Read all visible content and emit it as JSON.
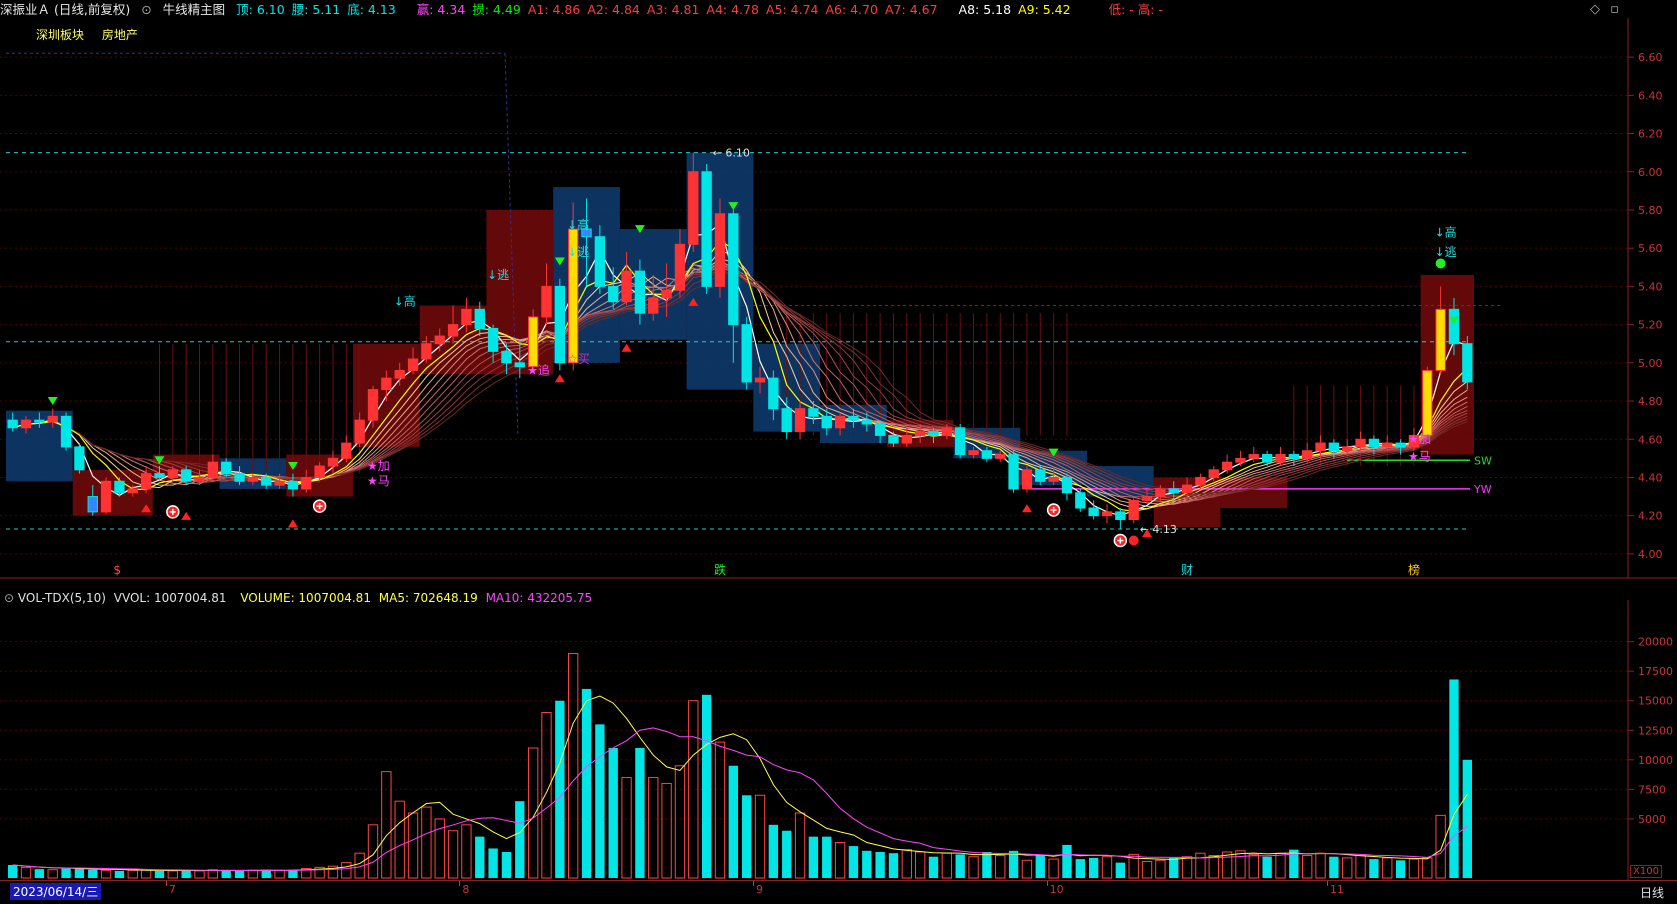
{
  "header": {
    "title": "深振业Ａ (日线,前复权)",
    "indicator": "牛线精主图",
    "fields": [
      {
        "label": "顶: 6.10",
        "color": "#00e5e5"
      },
      {
        "label": "腰: 5.11",
        "color": "#00e5e5"
      },
      {
        "label": "底: 4.13",
        "color": "#00e5e5"
      },
      {
        "label": "赢: 4.34",
        "color": "#ff44ff"
      },
      {
        "label": "损: 4.49",
        "color": "#00ee00"
      },
      {
        "label": "A1: 4.86",
        "color": "#ff3b3b"
      },
      {
        "label": "A2: 4.84",
        "color": "#ff3b3b"
      },
      {
        "label": "A3: 4.81",
        "color": "#ff3b3b"
      },
      {
        "label": "A4: 4.78",
        "color": "#ff3b3b"
      },
      {
        "label": "A5: 4.74",
        "color": "#ff3b3b"
      },
      {
        "label": "A6: 4.70",
        "color": "#ff3b3b"
      },
      {
        "label": "A7: 4.67",
        "color": "#ff3b3b"
      },
      {
        "label": "A8: 5.18",
        "color": "#ffffff"
      },
      {
        "label": "A9: 5.42",
        "color": "#ffff00"
      }
    ],
    "low_high": "低: - 高: -"
  },
  "sector": {
    "board": "深圳板块",
    "industry": "房地产"
  },
  "price_axis": [
    "6.60",
    "6.40",
    "6.20",
    "6.00",
    "5.80",
    "5.60",
    "5.40",
    "5.20",
    "5.00",
    "4.80",
    "4.60",
    "4.40",
    "4.20",
    "4.00"
  ],
  "volume_axis": [
    "20000",
    "17500",
    "15000",
    "12500",
    "10000",
    "7500",
    "5000"
  ],
  "volume_header": {
    "name": "VOL-TDX(5,10)",
    "vvol": "VVOL: 1007004.81",
    "volume": "VOLUME: 1007004.81",
    "ma5": "MA5: 702648.19",
    "ma10": "MA10: 432205.75"
  },
  "volume_unit": "X100",
  "annotations": {
    "top_price": "6.10",
    "bottom_price": "4.13",
    "sw": "SW",
    "yw": "YW",
    "event_markers": [
      "$",
      "跌",
      "财",
      "榜"
    ],
    "signals": [
      "↓高",
      "↓逃",
      "↓逃",
      "↓高",
      "★追",
      "☆买",
      "★加",
      "★马",
      "★加",
      "★马",
      "↓高",
      "↓逃"
    ]
  },
  "date_axis": {
    "start": "2023/06/14/三",
    "months": [
      "7",
      "8",
      "9",
      "10",
      "11"
    ],
    "period": "日线"
  },
  "colors": {
    "up": "#ff3333",
    "down": "#00e5e5",
    "bg": "#000000",
    "grid": "#5a0000"
  },
  "chart_data": {
    "type": "candlestick",
    "title": "深振业Ａ (日线,前复权)",
    "ylim": [
      3.9,
      6.7
    ],
    "volume_ylim": [
      0,
      22000
    ],
    "candles": [
      [
        4.7,
        4.66,
        4.74,
        4.64
      ],
      [
        4.66,
        4.7,
        4.72,
        4.63
      ],
      [
        4.7,
        4.69,
        4.74,
        4.66
      ],
      [
        4.69,
        4.72,
        4.76,
        4.66
      ],
      [
        4.72,
        4.56,
        4.74,
        4.54
      ],
      [
        4.56,
        4.44,
        4.58,
        4.42
      ],
      [
        4.3,
        4.22,
        4.36,
        4.2
      ],
      [
        4.22,
        4.38,
        4.4,
        4.21
      ],
      [
        4.38,
        4.32,
        4.4,
        4.3
      ],
      [
        4.32,
        4.34,
        4.36,
        4.3
      ],
      [
        4.34,
        4.42,
        4.46,
        4.32
      ],
      [
        4.42,
        4.4,
        4.46,
        4.38
      ],
      [
        4.4,
        4.44,
        4.46,
        4.38
      ],
      [
        4.44,
        4.38,
        4.46,
        4.36
      ],
      [
        4.38,
        4.4,
        4.44,
        4.36
      ],
      [
        4.4,
        4.48,
        4.52,
        4.38
      ],
      [
        4.48,
        4.42,
        4.5,
        4.4
      ],
      [
        4.42,
        4.38,
        4.46,
        4.36
      ],
      [
        4.38,
        4.4,
        4.42,
        4.36
      ],
      [
        4.4,
        4.36,
        4.42,
        4.34
      ],
      [
        4.36,
        4.38,
        4.42,
        4.34
      ],
      [
        4.38,
        4.34,
        4.42,
        4.3
      ],
      [
        4.34,
        4.4,
        4.44,
        4.32
      ],
      [
        4.4,
        4.46,
        4.48,
        4.38
      ],
      [
        4.46,
        4.5,
        4.54,
        4.42
      ],
      [
        4.5,
        4.58,
        4.62,
        4.48
      ],
      [
        4.58,
        4.7,
        4.74,
        4.56
      ],
      [
        4.7,
        4.86,
        4.88,
        4.66
      ],
      [
        4.86,
        4.92,
        4.96,
        4.8
      ],
      [
        4.92,
        4.96,
        5.0,
        4.88
      ],
      [
        4.96,
        5.02,
        5.08,
        4.94
      ],
      [
        5.02,
        5.1,
        5.14,
        5.0
      ],
      [
        5.1,
        5.14,
        5.18,
        5.06
      ],
      [
        5.14,
        5.2,
        5.3,
        5.1
      ],
      [
        5.2,
        5.28,
        5.34,
        5.16
      ],
      [
        5.28,
        5.18,
        5.32,
        5.14
      ],
      [
        5.18,
        5.06,
        5.2,
        5.0
      ],
      [
        5.06,
        5.0,
        5.1,
        4.94
      ],
      [
        5.0,
        4.98,
        5.12,
        4.92
      ],
      [
        4.98,
        5.24,
        5.28,
        4.96
      ],
      [
        5.24,
        5.4,
        5.52,
        5.2
      ],
      [
        5.4,
        5.0,
        5.44,
        4.96
      ],
      [
        5.0,
        5.7,
        5.84,
        4.96
      ],
      [
        5.7,
        5.66,
        5.86,
        5.4
      ],
      [
        5.66,
        5.4,
        5.72,
        5.36
      ],
      [
        5.4,
        5.32,
        5.5,
        5.28
      ],
      [
        5.32,
        5.48,
        5.58,
        5.3
      ],
      [
        5.48,
        5.26,
        5.54,
        5.2
      ],
      [
        5.26,
        5.34,
        5.46,
        5.22
      ],
      [
        5.34,
        5.38,
        5.52,
        5.24
      ],
      [
        5.38,
        5.62,
        5.7,
        5.34
      ],
      [
        5.62,
        6.0,
        6.1,
        5.58
      ],
      [
        6.0,
        5.4,
        6.04,
        5.36
      ],
      [
        5.4,
        5.78,
        5.86,
        5.34
      ],
      [
        5.78,
        5.2,
        5.8,
        5.0
      ],
      [
        5.2,
        4.9,
        5.24,
        4.86
      ],
      [
        4.9,
        4.92,
        4.98,
        4.84
      ],
      [
        4.92,
        4.76,
        4.96,
        4.7
      ],
      [
        4.76,
        4.64,
        4.82,
        4.6
      ],
      [
        4.64,
        4.76,
        4.8,
        4.6
      ],
      [
        4.76,
        4.72,
        4.8,
        4.68
      ],
      [
        4.72,
        4.66,
        4.76,
        4.62
      ],
      [
        4.66,
        4.72,
        4.74,
        4.62
      ],
      [
        4.72,
        4.7,
        4.76,
        4.66
      ],
      [
        4.7,
        4.68,
        4.74,
        4.64
      ],
      [
        4.68,
        4.62,
        4.7,
        4.58
      ],
      [
        4.62,
        4.58,
        4.64,
        4.56
      ],
      [
        4.58,
        4.62,
        4.66,
        4.56
      ],
      [
        4.62,
        4.64,
        4.68,
        4.58
      ],
      [
        4.64,
        4.62,
        4.66,
        4.58
      ],
      [
        4.62,
        4.66,
        4.68,
        4.6
      ],
      [
        4.66,
        4.52,
        4.68,
        4.5
      ],
      [
        4.52,
        4.54,
        4.56,
        4.5
      ],
      [
        4.54,
        4.5,
        4.56,
        4.48
      ],
      [
        4.5,
        4.52,
        4.54,
        4.48
      ],
      [
        4.52,
        4.34,
        4.54,
        4.32
      ],
      [
        4.34,
        4.44,
        4.46,
        4.32
      ],
      [
        4.44,
        4.38,
        4.46,
        4.36
      ],
      [
        4.38,
        4.4,
        4.46,
        4.36
      ],
      [
        4.4,
        4.32,
        4.42,
        4.28
      ],
      [
        4.32,
        4.24,
        4.34,
        4.22
      ],
      [
        4.24,
        4.2,
        4.28,
        4.18
      ],
      [
        4.2,
        4.22,
        4.26,
        4.16
      ],
      [
        4.22,
        4.18,
        4.24,
        4.13
      ],
      [
        4.18,
        4.28,
        4.3,
        4.16
      ],
      [
        4.28,
        4.3,
        4.34,
        4.26
      ],
      [
        4.3,
        4.34,
        4.36,
        4.28
      ],
      [
        4.34,
        4.32,
        4.38,
        4.26
      ],
      [
        4.32,
        4.36,
        4.4,
        4.28
      ],
      [
        4.36,
        4.4,
        4.42,
        4.34
      ],
      [
        4.4,
        4.44,
        4.46,
        4.38
      ],
      [
        4.44,
        4.48,
        4.52,
        4.42
      ],
      [
        4.48,
        4.5,
        4.54,
        4.46
      ],
      [
        4.5,
        4.52,
        4.56,
        4.48
      ],
      [
        4.52,
        4.48,
        4.54,
        4.46
      ],
      [
        4.48,
        4.52,
        4.56,
        4.46
      ],
      [
        4.52,
        4.5,
        4.54,
        4.46
      ],
      [
        4.5,
        4.54,
        4.58,
        4.48
      ],
      [
        4.54,
        4.58,
        4.62,
        4.5
      ],
      [
        4.58,
        4.54,
        4.6,
        4.5
      ],
      [
        4.54,
        4.56,
        4.6,
        4.52
      ],
      [
        4.56,
        4.6,
        4.64,
        4.54
      ],
      [
        4.6,
        4.56,
        4.62,
        4.52
      ],
      [
        4.56,
        4.58,
        4.62,
        4.54
      ],
      [
        4.58,
        4.56,
        4.6,
        4.52
      ],
      [
        4.56,
        4.62,
        4.66,
        4.54
      ],
      [
        4.62,
        4.96,
        4.98,
        4.6
      ],
      [
        4.96,
        5.28,
        5.4,
        4.94
      ],
      [
        5.28,
        5.1,
        5.34,
        5.04
      ],
      [
        5.1,
        4.9,
        5.14,
        4.86
      ]
    ],
    "volumes": [
      1100,
      900,
      750,
      700,
      800,
      850,
      700,
      650,
      600,
      650,
      700,
      600,
      600,
      650,
      600,
      700,
      650,
      600,
      650,
      700,
      650,
      700,
      800,
      900,
      1000,
      1300,
      2100,
      4500,
      9000,
      6500,
      5500,
      6000,
      5000,
      4000,
      4500,
      3500,
      2500,
      2200,
      6500,
      11000,
      14000,
      15000,
      19000,
      16000,
      13000,
      11000,
      8500,
      11000,
      8500,
      8000,
      9500,
      15000,
      15500,
      11500,
      9500,
      7000,
      7000,
      4500,
      4000,
      5500,
      3500,
      3500,
      3000,
      2700,
      2300,
      2200,
      2100,
      2400,
      2200,
      1800,
      2100,
      2000,
      1800,
      2200,
      1900,
      2300,
      1500,
      1900,
      1600,
      2800,
      1600,
      1700,
      1800,
      1300,
      2000,
      1400,
      1500,
      1700,
      1800,
      2100,
      1900,
      2200,
      2300,
      2000,
      1800,
      2100,
      2400,
      1900,
      2100,
      1800,
      1700,
      1900,
      1600,
      1700,
      1500,
      1600,
      1700,
      5300,
      16800,
      10000
    ],
    "series": [
      {
        "name": "MA5"
      },
      {
        "name": "MA10"
      }
    ]
  }
}
